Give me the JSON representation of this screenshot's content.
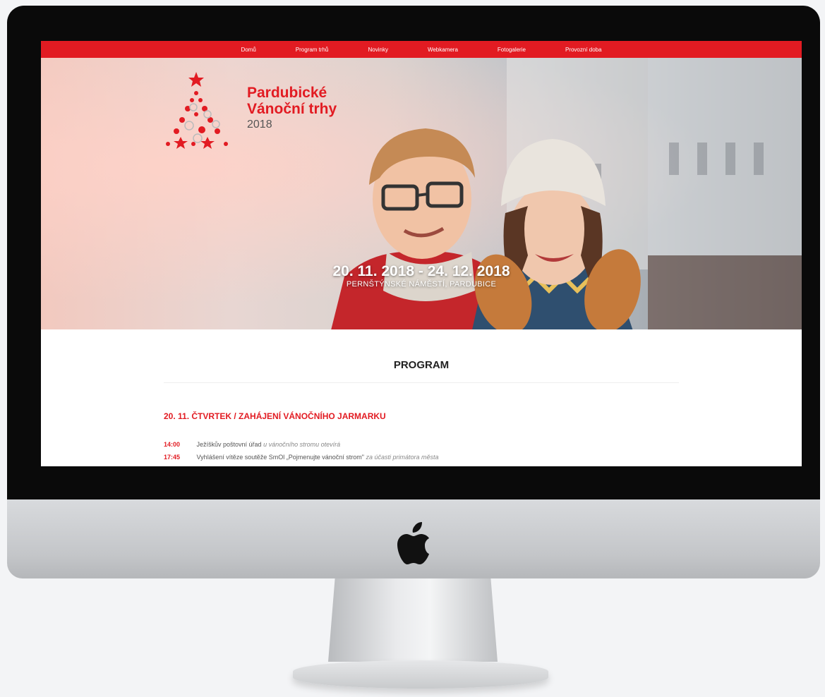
{
  "nav": {
    "items": [
      "Domů",
      "Program trhů",
      "Novinky",
      "Webkamera",
      "Fotogalerie",
      "Provozní doba"
    ]
  },
  "hero": {
    "title_line1": "Pardubické",
    "title_line2": "Vánoční trhy",
    "year": "2018",
    "dates": "20. 11. 2018 - 24. 12. 2018",
    "location": "PERNŠTÝNSKÉ NÁMĚSTÍ, PARDUBICE"
  },
  "program": {
    "heading": "PROGRAM",
    "day_heading": "20. 11. ČTVRTEK / ZAHÁJENÍ VÁNOČNÍHO JARMARKU",
    "events": [
      {
        "time": "14:00",
        "text": "Ježíškův poštovní úřad",
        "note": "u vánočního stromu otevírá"
      },
      {
        "time": "17:45",
        "text": "Vyhlášení vítěze soutěže SmOl „Pojmenujte vánoční strom\"",
        "note": "za účasti primátora města"
      }
    ]
  },
  "colors": {
    "accent": "#e21b22"
  },
  "icons": {
    "brand": "apple-logo-icon",
    "logo": "christmas-tree-logo-icon"
  }
}
